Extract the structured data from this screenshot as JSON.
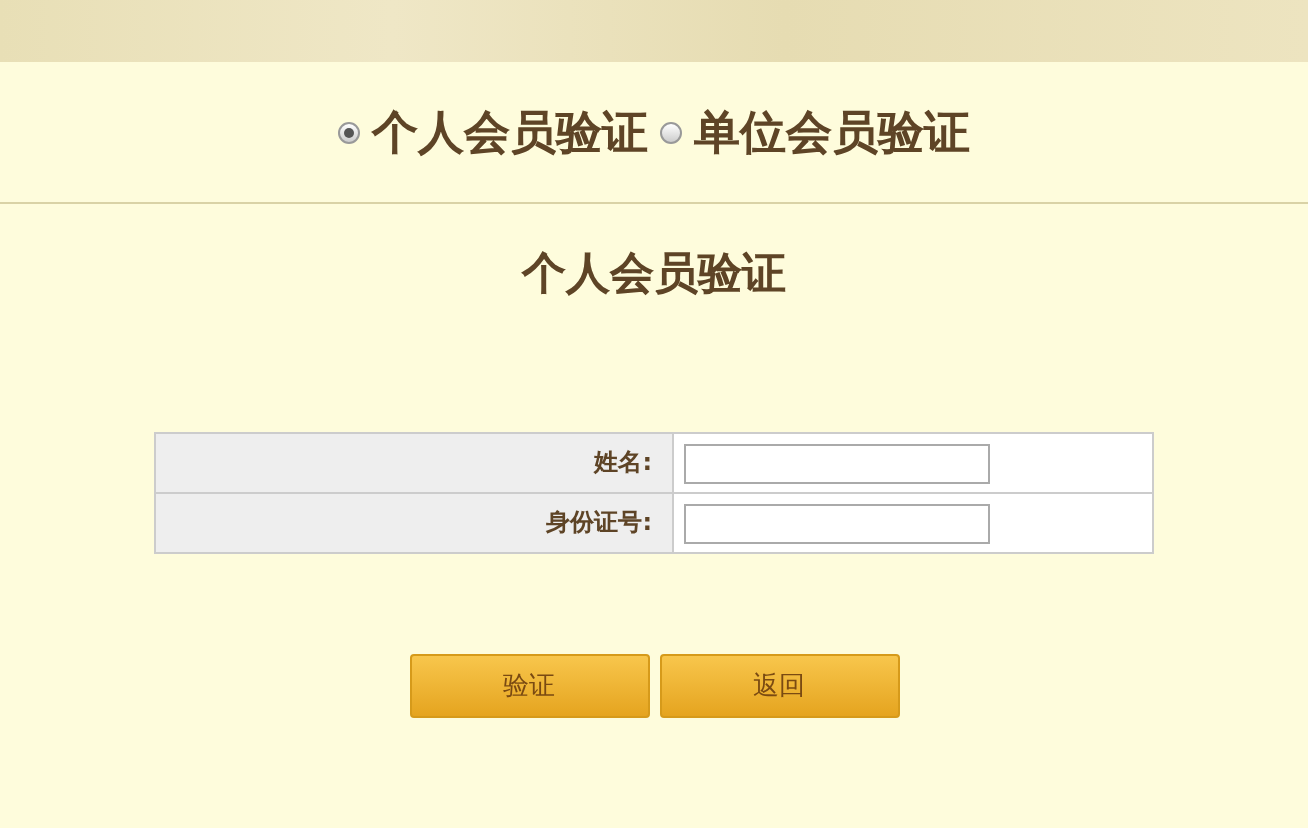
{
  "member_types": [
    {
      "label": "个人会员验证",
      "selected": true
    },
    {
      "label": "单位会员验证",
      "selected": false
    }
  ],
  "heading": "个人会员验证",
  "form": {
    "fields": [
      {
        "label": "姓名:"
      },
      {
        "label": "身份证号:"
      }
    ]
  },
  "buttons": [
    "验证",
    "返回"
  ]
}
